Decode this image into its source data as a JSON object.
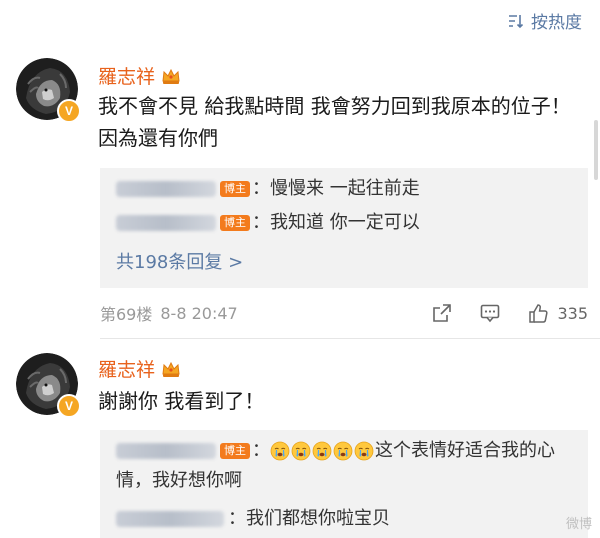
{
  "sort": {
    "label": "按热度",
    "icon": "sort-icon"
  },
  "colors": {
    "username": "#e8621c",
    "link": "#5b7aa4",
    "blogger_tag": "#f37b1d",
    "reply_bg": "#f2f2f2"
  },
  "comments": [
    {
      "username": "羅志祥",
      "verified": "V",
      "avatar": "lion-avatar",
      "text": "我不會不見 給我點時間 我會努力回到我原本的位子！因為還有你們",
      "replies": [
        {
          "tag": "博主",
          "text": "：慢慢来 一起往前走"
        },
        {
          "tag": "博主",
          "text": "：我知道 你一定可以"
        }
      ],
      "more_replies": "共198条回复 >",
      "floor": "第69楼",
      "date": "8-8 20:47",
      "likes": "335"
    },
    {
      "username": "羅志祥",
      "verified": "V",
      "avatar": "lion-avatar",
      "text": "謝謝你 我看到了！",
      "replies": [
        {
          "tag": "博主",
          "text_after_emoji": "这个表情好适合我的心情，我好想你啊",
          "emoji_count": 5,
          "emoji": "crying-face-icon"
        },
        {
          "tag": "",
          "text": "：我们都想你啦宝贝"
        }
      ]
    }
  ]
}
